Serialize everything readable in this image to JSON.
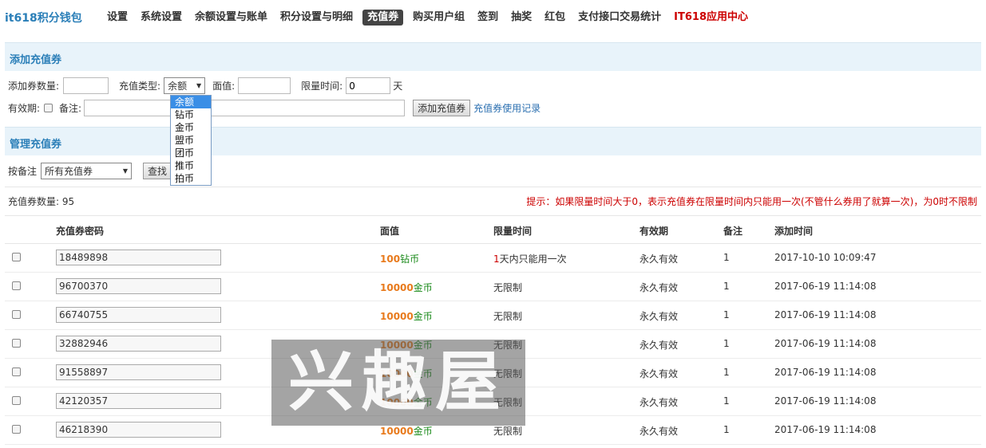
{
  "brand": "it618积分钱包",
  "nav": [
    {
      "label": "设置",
      "active": false
    },
    {
      "label": "系统设置",
      "active": false
    },
    {
      "label": "余额设置与账单",
      "active": false
    },
    {
      "label": "积分设置与明细",
      "active": false
    },
    {
      "label": "充值券",
      "active": true
    },
    {
      "label": "购买用户组",
      "active": false
    },
    {
      "label": "签到",
      "active": false
    },
    {
      "label": "抽奖",
      "active": false
    },
    {
      "label": "红包",
      "active": false
    },
    {
      "label": "支付接口交易统计",
      "active": false
    },
    {
      "label": "IT618应用中心",
      "active": false
    }
  ],
  "add_section": {
    "title": "添加充值券",
    "count_label": "添加券数量:",
    "count_value": "",
    "type_label": "充值类型:",
    "type_selected": "余额",
    "type_options": [
      "余额",
      "钻币",
      "金币",
      "盟币",
      "团币",
      "推币",
      "拍币"
    ],
    "face_label": "面值:",
    "face_value": "",
    "limit_label": "限量时间:",
    "limit_value": "0",
    "limit_unit": "天",
    "validity_label": "有效期:",
    "note_label": "备注:",
    "note_value": "",
    "add_button": "添加充值券",
    "records_link": "充值券使用记录"
  },
  "manage_section": {
    "title": "管理充值券",
    "filter_label": "按备注",
    "filter_selected": "所有充值券",
    "search_button": "查找",
    "count_text": "充值券数量: 95",
    "hint": "提示：如果限量时间大于0，表示充值券在限量时间内只能用一次(不管什么券用了就算一次)，为0时不限制"
  },
  "table": {
    "headers": [
      "充值券密码",
      "面值",
      "限量时间",
      "有效期",
      "备注",
      "添加时间"
    ],
    "rows": [
      {
        "password": "18489898",
        "amount": "100",
        "currency": "钻币",
        "limit_days": "1",
        "limit_text": "天内只能用一次",
        "validity": "永久有效",
        "note": "1",
        "added": "2017-10-10 10:09:47"
      },
      {
        "password": "96700370",
        "amount": "10000",
        "currency": "金币",
        "limit_days": "",
        "limit_text": "无限制",
        "validity": "永久有效",
        "note": "1",
        "added": "2017-06-19 11:14:08"
      },
      {
        "password": "66740755",
        "amount": "10000",
        "currency": "金币",
        "limit_days": "",
        "limit_text": "无限制",
        "validity": "永久有效",
        "note": "1",
        "added": "2017-06-19 11:14:08"
      },
      {
        "password": "32882946",
        "amount": "10000",
        "currency": "金币",
        "limit_days": "",
        "limit_text": "无限制",
        "validity": "永久有效",
        "note": "1",
        "added": "2017-06-19 11:14:08"
      },
      {
        "password": "91558897",
        "amount": "10000",
        "currency": "金币",
        "limit_days": "",
        "limit_text": "无限制",
        "validity": "永久有效",
        "note": "1",
        "added": "2017-06-19 11:14:08"
      },
      {
        "password": "42120357",
        "amount": "10000",
        "currency": "金币",
        "limit_days": "",
        "limit_text": "无限制",
        "validity": "永久有效",
        "note": "1",
        "added": "2017-06-19 11:14:08"
      },
      {
        "password": "46218390",
        "amount": "10000",
        "currency": "金币",
        "limit_days": "",
        "limit_text": "无限制",
        "validity": "永久有效",
        "note": "1",
        "added": "2017-06-19 11:14:08"
      }
    ]
  },
  "watermark": "兴趣屋"
}
